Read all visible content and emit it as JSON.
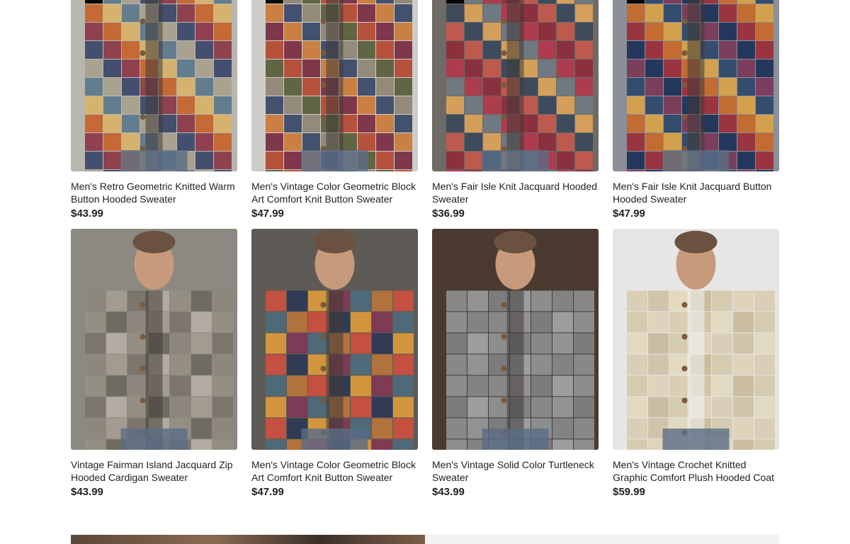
{
  "products": [
    {
      "title": "Men's Retro Geometric Knitted Warm Button Hooded Sweater",
      "price": "$43.99",
      "colors": [
        "#3d4a6b",
        "#8c3b4a",
        "#c5652e",
        "#d6b36a",
        "#5d7a8c",
        "#a9a18e"
      ],
      "bg": "#b9b6ae"
    },
    {
      "title": "Men's Vintage Color Geometric Block Art Comfort Knit Button Sweater",
      "price": "$47.99",
      "colors": [
        "#b44a34",
        "#7a2f44",
        "#c97a3c",
        "#3b4a6a",
        "#8f8676",
        "#5a5f3c"
      ],
      "bg": "#cfcdc9"
    },
    {
      "title": "Men's Fair Isle Knit Jacquard Hooded Sweater",
      "price": "$36.99",
      "colors": [
        "#8c2e3c",
        "#c1584c",
        "#3a4a5c",
        "#d9a25a",
        "#6f7a83",
        "#b03a4e"
      ],
      "bg": "#6e6a66"
    },
    {
      "title": "Men's Fair Isle Knit Jacquard Button Hooded Sweater",
      "price": "$47.99",
      "colors": [
        "#1f3358",
        "#9b2f3a",
        "#c56a2b",
        "#d7a24a",
        "#2f4a6c",
        "#7a3a5a"
      ],
      "bg": "#8a8f98"
    },
    {
      "title": "Vintage Fairman Island Jacquard Zip Hooded Cardigan Sweater",
      "price": "$43.99",
      "colors": [
        "#8e877c",
        "#a39c90",
        "#7b746a",
        "#b3ad a2",
        "#958e83",
        "#6f695f"
      ],
      "bg": "#8c8882"
    },
    {
      "title": "Men's Vintage Color Geometric Block Art Comfort Knit Button Sweater",
      "price": "$47.99",
      "colors": [
        "#c8503f",
        "#2e3a55",
        "#d79a3c",
        "#7e3a55",
        "#4d6a7a",
        "#b5743a"
      ],
      "bg": "#5e5a55"
    },
    {
      "title": "Men's Vintage Solid Color Turtleneck Sweater",
      "price": "$43.99",
      "colors": [
        "#8a8c8f",
        "#96989b",
        "#7e8083",
        "#a0a2a5",
        "#8f9194",
        "#85878a"
      ],
      "bg": "#4a3a30"
    },
    {
      "title": "Men's Vintage Crochet Knitted Graphic Comfort Plush Hooded Coat",
      "price": "$59.99",
      "colors": [
        "#d9ceb3",
        "#cfc3a6",
        "#e2d8bf",
        "#c8bb9c",
        "#d4c9ad",
        "#ddd2b8"
      ],
      "bg": "#e6e6e6"
    }
  ]
}
